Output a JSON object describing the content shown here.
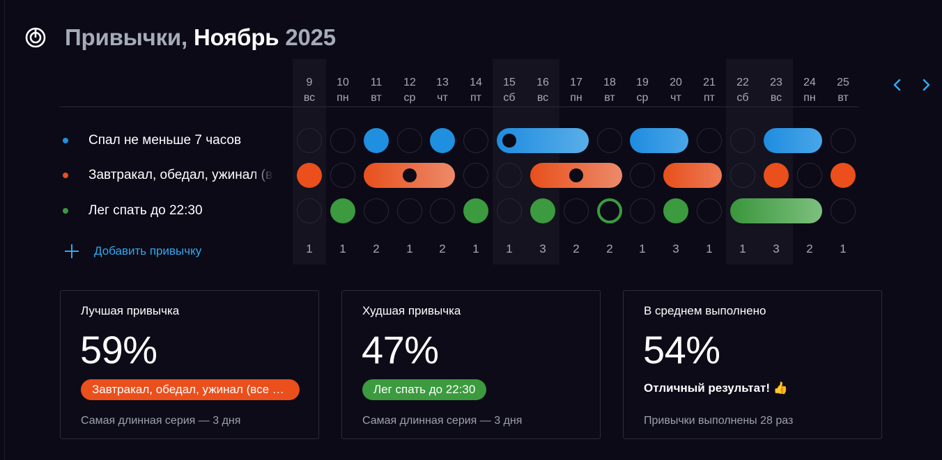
{
  "header": {
    "title_prefix": "Привычки,",
    "title_month": "Ноябрь",
    "title_year": "2025",
    "logo_icon": "target-icon"
  },
  "nav": {
    "prev_icon": "chevron-left-icon",
    "next_icon": "chevron-right-icon",
    "accent": "#2fa9f0"
  },
  "days": [
    {
      "num": "9",
      "wd": "вс"
    },
    {
      "num": "10",
      "wd": "пн"
    },
    {
      "num": "11",
      "wd": "вт"
    },
    {
      "num": "12",
      "wd": "ср"
    },
    {
      "num": "13",
      "wd": "чт"
    },
    {
      "num": "14",
      "wd": "пт"
    },
    {
      "num": "15",
      "wd": "сб"
    },
    {
      "num": "16",
      "wd": "вс"
    },
    {
      "num": "17",
      "wd": "пн"
    },
    {
      "num": "18",
      "wd": "вт"
    },
    {
      "num": "19",
      "wd": "ср"
    },
    {
      "num": "20",
      "wd": "чт"
    },
    {
      "num": "21",
      "wd": "пт"
    },
    {
      "num": "22",
      "wd": "сб"
    },
    {
      "num": "23",
      "wd": "вс"
    },
    {
      "num": "24",
      "wd": "пн"
    },
    {
      "num": "25",
      "wd": "вт"
    }
  ],
  "habits": [
    {
      "name": "Спал не меньше 7 часов",
      "color": "#1f8fe0"
    },
    {
      "name": "Завтракал, обедал, ужинал (все приемы пищи)",
      "color": "#ea4f1c"
    },
    {
      "name": "Лег спать до 22:30",
      "color": "#3b9b3e"
    }
  ],
  "daily_counts": [
    "1",
    "1",
    "2",
    "1",
    "2",
    "1",
    "1",
    "3",
    "2",
    "2",
    "1",
    "3",
    "1",
    "1",
    "3",
    "2",
    "1"
  ],
  "add_habit_label": "Добавить привычку",
  "stats": {
    "best": {
      "title": "Лучшая привычка",
      "value": "59%",
      "badge": "Завтракал, обедал, ужинал (все приемы пищи)",
      "badge_color": "#ea4f1c",
      "streak": "Самая длинная серия — 3 дня"
    },
    "worst": {
      "title": "Худшая привычка",
      "value": "47%",
      "badge": "Лег спать до 22:30",
      "badge_color": "#3b9b3e",
      "streak": "Самая длинная серия — 3 дня"
    },
    "average": {
      "title": "В среднем выполнено",
      "value": "54%",
      "note": "Отличный результат! 👍",
      "total": "Привычки выполнены 28 раз"
    }
  }
}
